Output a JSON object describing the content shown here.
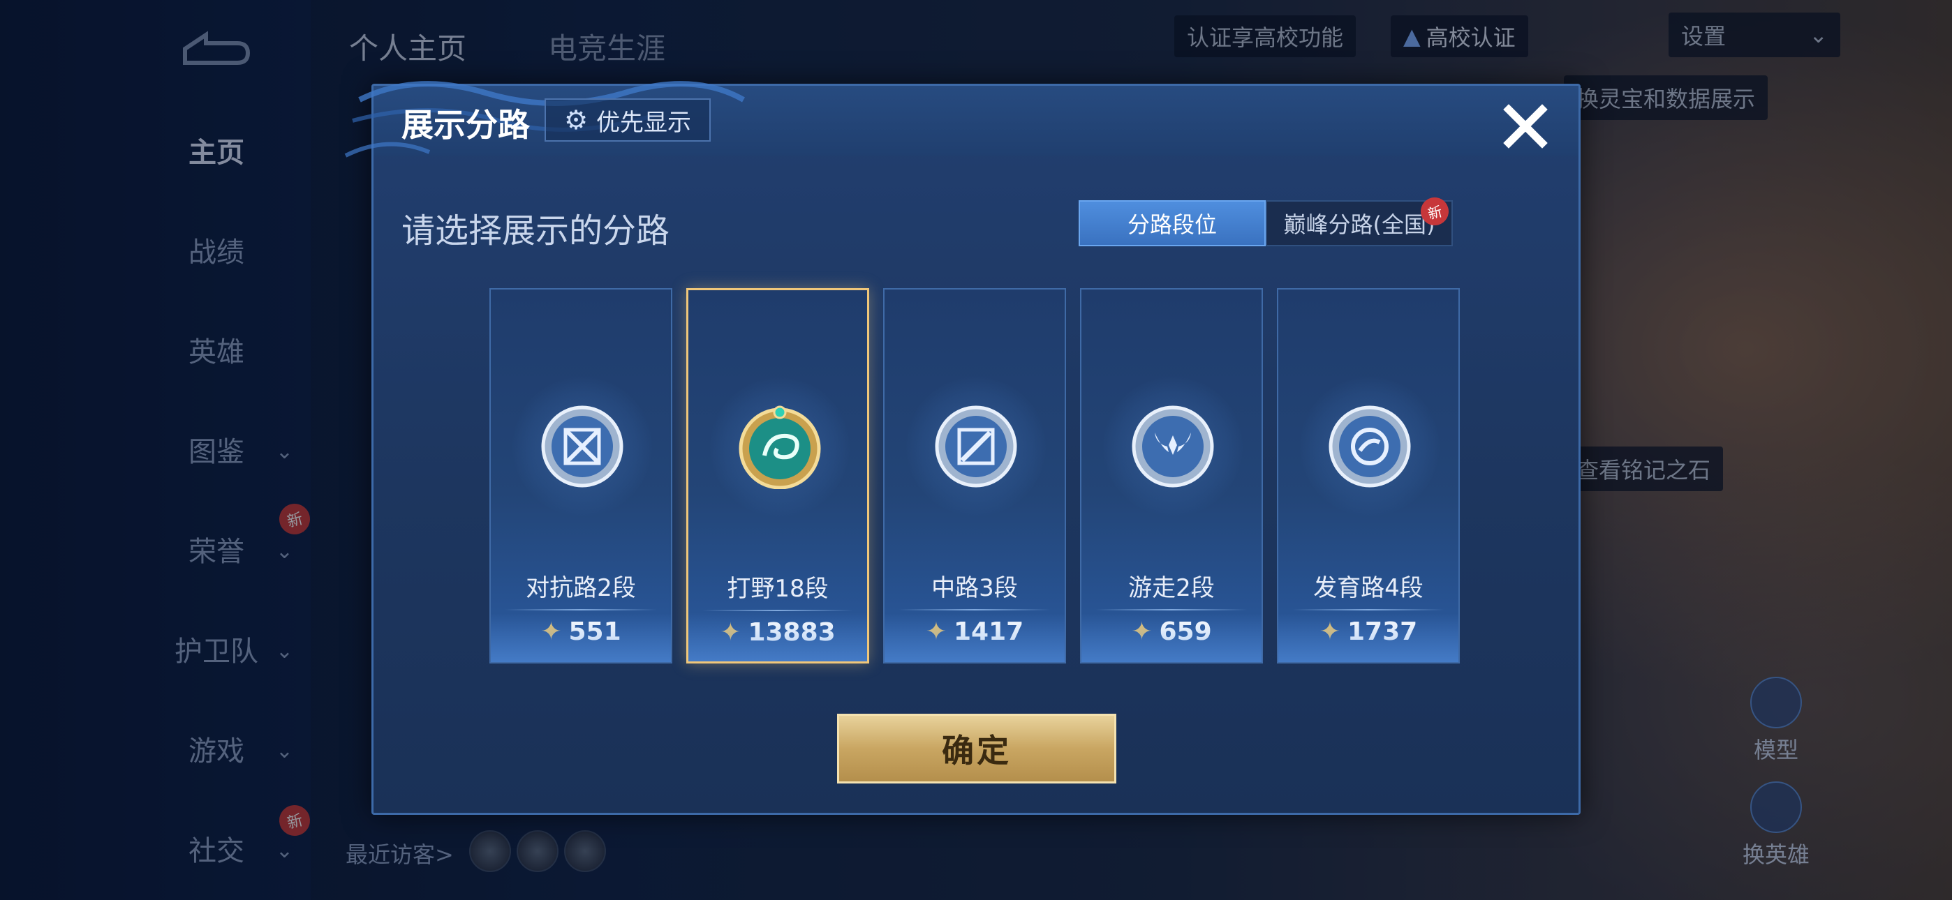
{
  "background": {
    "top_tabs": [
      "个人主页",
      "电竞生涯"
    ],
    "nav_items": [
      {
        "label": "主页",
        "active": true,
        "chevron": false,
        "new": false
      },
      {
        "label": "战绩",
        "active": false,
        "chevron": false,
        "new": false
      },
      {
        "label": "英雄",
        "active": false,
        "chevron": false,
        "new": false
      },
      {
        "label": "图鉴",
        "active": false,
        "chevron": true,
        "new": false
      },
      {
        "label": "荣誉",
        "active": false,
        "chevron": true,
        "new": true
      },
      {
        "label": "护卫队",
        "active": false,
        "chevron": true,
        "new": false
      },
      {
        "label": "游戏",
        "active": false,
        "chevron": true,
        "new": false
      },
      {
        "label": "社交",
        "active": false,
        "chevron": true,
        "new": true
      }
    ],
    "new_badge": "新",
    "cert_text": "认证享高校功能",
    "cert_button": "高校认证",
    "settings": "设置",
    "banner_text": "换灵宝和数据展示",
    "inscription_text": "查看铭记之石",
    "visitors": "最近访客>",
    "side_actions": [
      "模型",
      "换英雄"
    ]
  },
  "dialog": {
    "title": "展示分路",
    "priority_button": "优先显示",
    "subtitle": "请选择展示的分路",
    "tabs": [
      {
        "label": "分路段位",
        "active": true
      },
      {
        "label": "巅峰分路(全国)",
        "active": false,
        "badge": "新"
      }
    ],
    "lanes": [
      {
        "name": "对抗路2段",
        "score": "551",
        "selected": false,
        "icon": "swords-icon"
      },
      {
        "name": "打野18段",
        "score": "13883",
        "selected": true,
        "icon": "dragon-icon"
      },
      {
        "name": "中路3段",
        "score": "1417",
        "selected": false,
        "icon": "wand-icon"
      },
      {
        "name": "游走2段",
        "score": "659",
        "selected": false,
        "icon": "wings-icon"
      },
      {
        "name": "发育路4段",
        "score": "1737",
        "selected": false,
        "icon": "bow-icon"
      }
    ],
    "confirm_button": "确定"
  },
  "colors": {
    "accent_blue": "#3a72c0",
    "gold": "#c9a662",
    "selected_border": "#f0c77a",
    "badge_red": "#c7373a"
  }
}
